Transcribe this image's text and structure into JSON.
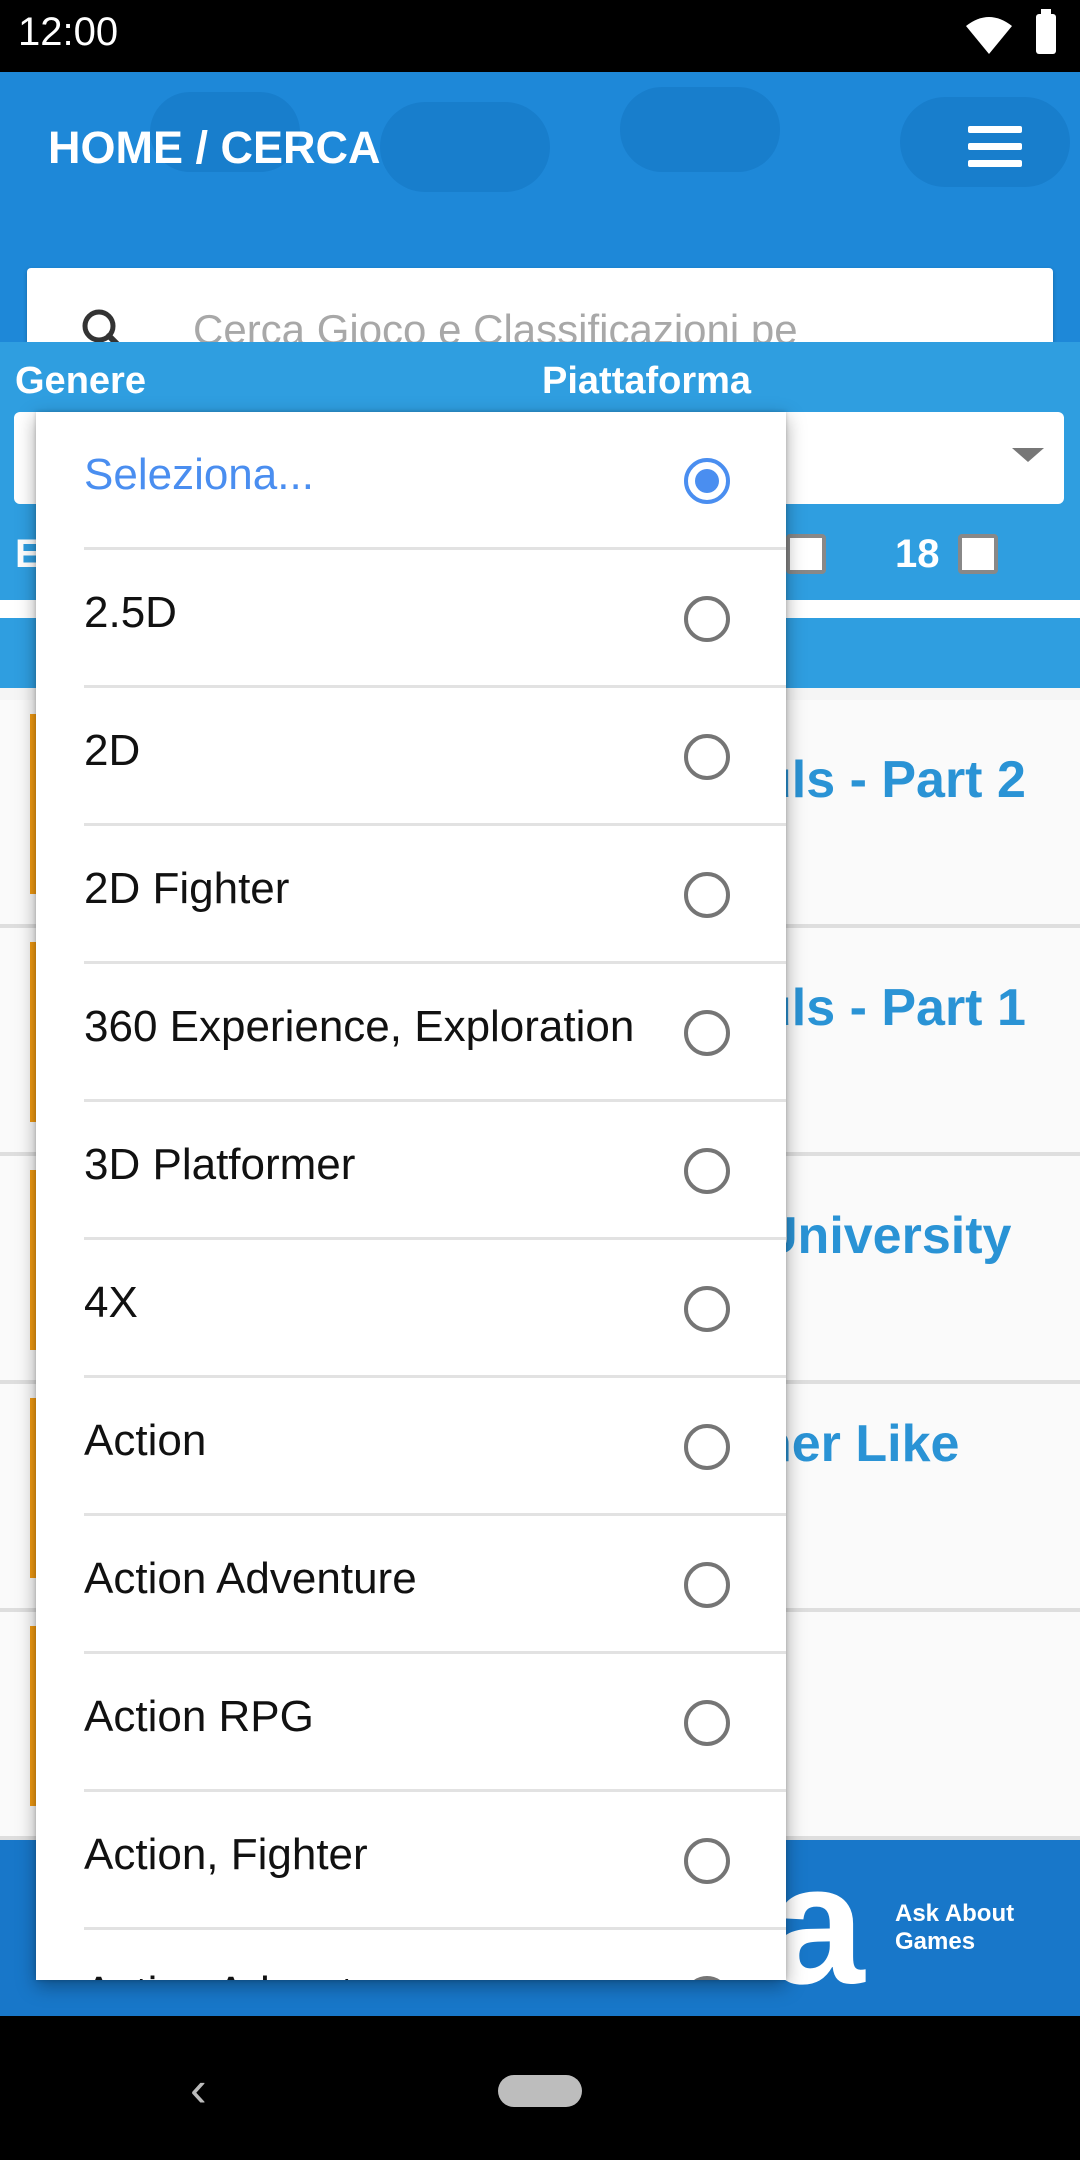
{
  "status_bar": {
    "time": "12:00"
  },
  "header": {
    "title": "HOME / CERCA",
    "search_placeholder": "Cerca Gioco e Classificazioni pe"
  },
  "filters": {
    "genre_label": "Genere",
    "platform_label": "Piattaforma",
    "age_partial_label": "E",
    "age_18_label": "18"
  },
  "results": [
    {
      "title_visible": "uls - Part 2"
    },
    {
      "title_visible": "uls - Part 1"
    },
    {
      "title_visible": "University"
    },
    {
      "title_visible": "her Like"
    },
    {
      "title_visible": ""
    }
  ],
  "banner": {
    "logo_letter": "a",
    "tagline_line1": "Ask About",
    "tagline_line2": "Games"
  },
  "genre_dropdown": {
    "selected": "Seleziona...",
    "options": [
      "Seleziona...",
      "2.5D",
      "2D",
      "2D Fighter",
      "360 Experience, Exploration",
      "3D Platformer",
      "4X",
      "Action",
      "Action Adventure",
      "Action RPG",
      "Action, Fighter",
      "Action Adventure"
    ]
  },
  "colors": {
    "header_blue": "#1e88d8",
    "filter_blue": "#2f9ee0",
    "accent_blue": "#4a8ef0",
    "title_blue": "#2a93d5"
  }
}
